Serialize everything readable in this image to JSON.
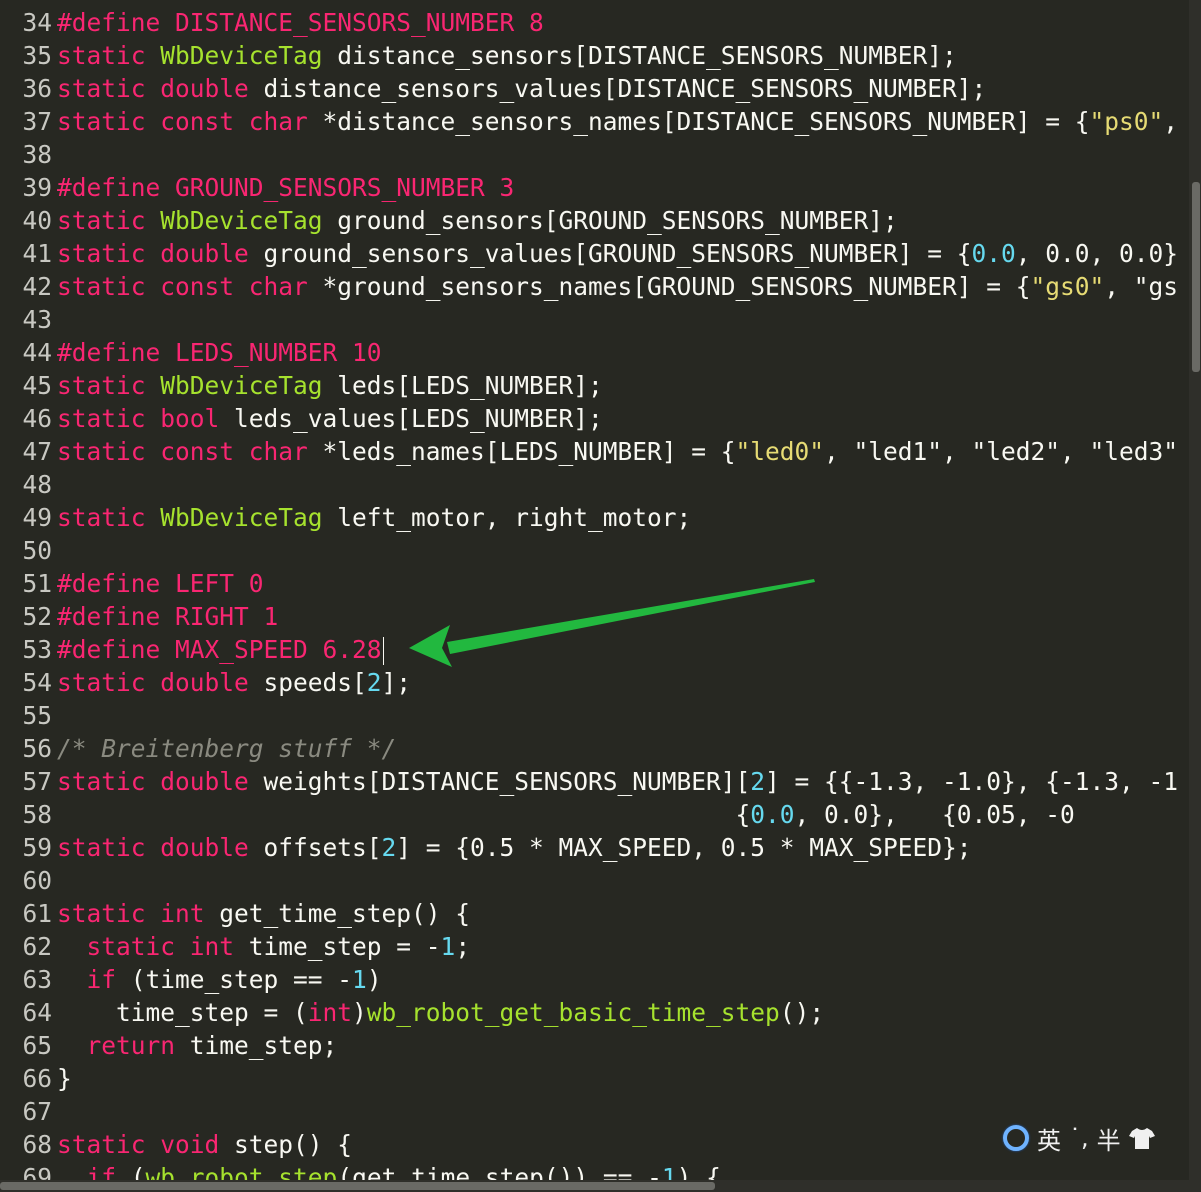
{
  "editor": {
    "lines": [
      {
        "n": "34",
        "parts": [
          [
            "kw",
            "#define DISTANCE_SENSORS_NUMBER 8"
          ]
        ]
      },
      {
        "n": "35",
        "parts": [
          [
            "kw",
            "static "
          ],
          [
            "ty",
            "WbDeviceTag"
          ],
          [
            "",
            " distance_sensors[DISTANCE_SENSORS_NUMBER];"
          ]
        ]
      },
      {
        "n": "36",
        "parts": [
          [
            "kw",
            "static double"
          ],
          [
            "",
            " distance_sensors_values[DISTANCE_SENSORS_NUMBER];"
          ]
        ]
      },
      {
        "n": "37",
        "parts": [
          [
            "kw",
            "static const char"
          ],
          [
            "",
            " *distance_sensors_names[DISTANCE_SENSORS_NUMBER] = {"
          ],
          [
            "st",
            "\"ps0\""
          ],
          [
            "",
            ", "
          ]
        ]
      },
      {
        "n": "38",
        "parts": []
      },
      {
        "n": "39",
        "parts": [
          [
            "kw",
            "#define GROUND_SENSORS_NUMBER 3"
          ]
        ]
      },
      {
        "n": "40",
        "parts": [
          [
            "kw",
            "static "
          ],
          [
            "ty",
            "WbDeviceTag"
          ],
          [
            "",
            " ground_sensors[GROUND_SENSORS_NUMBER];"
          ]
        ]
      },
      {
        "n": "41",
        "parts": [
          [
            "kw",
            "static double"
          ],
          [
            "",
            " ground_sensors_values[GROUND_SENSORS_NUMBER] = {"
          ],
          [
            "nm",
            "0.0"
          ],
          [
            "",
            ", 0.0, 0.0}"
          ]
        ]
      },
      {
        "n": "42",
        "parts": [
          [
            "kw",
            "static const char"
          ],
          [
            "",
            " *ground_sensors_names[GROUND_SENSORS_NUMBER] = {"
          ],
          [
            "st",
            "\"gs0\""
          ],
          [
            "",
            ", \"gs"
          ]
        ]
      },
      {
        "n": "43",
        "parts": []
      },
      {
        "n": "44",
        "parts": [
          [
            "kw",
            "#define LEDS_NUMBER 10"
          ]
        ]
      },
      {
        "n": "45",
        "parts": [
          [
            "kw",
            "static "
          ],
          [
            "ty",
            "WbDeviceTag"
          ],
          [
            "",
            " leds[LEDS_NUMBER];"
          ]
        ]
      },
      {
        "n": "46",
        "parts": [
          [
            "kw",
            "static bool"
          ],
          [
            "",
            " leds_values[LEDS_NUMBER];"
          ]
        ]
      },
      {
        "n": "47",
        "parts": [
          [
            "kw",
            "static const char"
          ],
          [
            "",
            " *leds_names[LEDS_NUMBER] = {"
          ],
          [
            "st",
            "\"led0\""
          ],
          [
            "",
            ", \"led1\", \"led2\", \"led3\""
          ]
        ]
      },
      {
        "n": "48",
        "parts": []
      },
      {
        "n": "49",
        "parts": [
          [
            "kw",
            "static "
          ],
          [
            "ty",
            "WbDeviceTag"
          ],
          [
            "",
            " left_motor, right_motor;"
          ]
        ]
      },
      {
        "n": "50",
        "parts": []
      },
      {
        "n": "51",
        "parts": [
          [
            "kw",
            "#define LEFT 0"
          ]
        ]
      },
      {
        "n": "52",
        "parts": [
          [
            "kw",
            "#define RIGHT 1"
          ]
        ]
      },
      {
        "n": "53",
        "parts": [
          [
            "kw",
            "#define MAX_SPEED 6.28"
          ]
        ],
        "caret": true
      },
      {
        "n": "54",
        "parts": [
          [
            "kw",
            "static double"
          ],
          [
            "",
            " speeds["
          ],
          [
            "nm",
            "2"
          ],
          [
            "",
            "];"
          ]
        ]
      },
      {
        "n": "55",
        "parts": []
      },
      {
        "n": "56",
        "parts": [
          [
            "cm",
            "/* Breitenberg stuff */"
          ]
        ]
      },
      {
        "n": "57",
        "parts": [
          [
            "kw",
            "static double"
          ],
          [
            "",
            " weights[DISTANCE_SENSORS_NUMBER]["
          ],
          [
            "nm",
            "2"
          ],
          [
            "",
            "] = {{-1.3, -1.0}, {-1.3, -1"
          ]
        ]
      },
      {
        "n": "58",
        "parts": [
          [
            "",
            "                                              {"
          ],
          [
            "nm",
            "0.0"
          ],
          [
            "",
            ", 0.0},   {0.05, -0"
          ]
        ]
      },
      {
        "n": "59",
        "parts": [
          [
            "kw",
            "static double"
          ],
          [
            "",
            " offsets["
          ],
          [
            "nm",
            "2"
          ],
          [
            "",
            "] = {0.5 * MAX_SPEED, 0.5 * MAX_SPEED};"
          ]
        ]
      },
      {
        "n": "60",
        "parts": []
      },
      {
        "n": "61",
        "parts": [
          [
            "kw",
            "static int"
          ],
          [
            "",
            " get_time_step() {"
          ]
        ]
      },
      {
        "n": "62",
        "parts": [
          [
            "",
            "  "
          ],
          [
            "kw",
            "static int"
          ],
          [
            "",
            " time_step = -"
          ],
          [
            "nm",
            "1"
          ],
          [
            "",
            ";"
          ]
        ]
      },
      {
        "n": "63",
        "parts": [
          [
            "",
            "  "
          ],
          [
            "kw",
            "if"
          ],
          [
            "",
            " (time_step == -"
          ],
          [
            "nm",
            "1"
          ],
          [
            "",
            ")"
          ]
        ]
      },
      {
        "n": "64",
        "parts": [
          [
            "",
            "    time_step = ("
          ],
          [
            "kw",
            "int"
          ],
          [
            "",
            ")"
          ],
          [
            "fn",
            "wb_robot_get_basic_time_step"
          ],
          [
            "",
            "();"
          ]
        ]
      },
      {
        "n": "65",
        "parts": [
          [
            "",
            "  "
          ],
          [
            "kw",
            "return"
          ],
          [
            "",
            " time_step;"
          ]
        ]
      },
      {
        "n": "66",
        "parts": [
          [
            "",
            "}"
          ]
        ]
      },
      {
        "n": "67",
        "parts": []
      },
      {
        "n": "68",
        "parts": [
          [
            "kw",
            "static void"
          ],
          [
            "",
            " step() {"
          ]
        ]
      },
      {
        "n": "69",
        "parts": [
          [
            "",
            "  "
          ],
          [
            "kw",
            "if"
          ],
          [
            "",
            " ("
          ],
          [
            "fn",
            "wb_robot_step"
          ],
          [
            "",
            "(get_time_step()) == -"
          ],
          [
            "nm",
            "1"
          ],
          [
            "",
            ") {"
          ]
        ]
      }
    ]
  },
  "ime": {
    "mode_label": "英",
    "punct_label": "˙,",
    "width_label": "半"
  },
  "colors": {
    "background": "#272822",
    "keyword": "#f92672",
    "type": "#a6e22e",
    "number": "#66d9ef",
    "string": "#e6db74",
    "comment": "#8a8a80",
    "arrow": "#22b83f"
  }
}
